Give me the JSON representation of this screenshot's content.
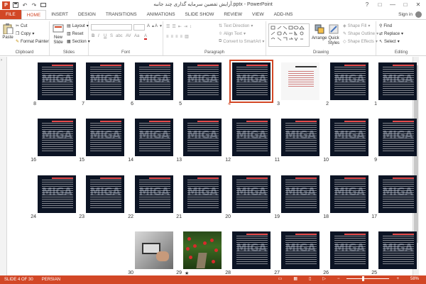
{
  "window": {
    "title": "آرایش تفضین سرمایه گذاری چند جانبه.pptx - PowerPoint",
    "app_icon": "P",
    "controls": [
      "?",
      "□",
      "—",
      "□",
      "✕"
    ]
  },
  "qat": {
    "save_icon": "save-icon",
    "undo_icon": "undo-icon",
    "redo_icon": "redo-icon"
  },
  "tabs": [
    "FILE",
    "HOME",
    "INSERT",
    "DESIGN",
    "TRANSITIONS",
    "ANIMATIONS",
    "SLIDE SHOW",
    "REVIEW",
    "VIEW",
    "ADD-INS"
  ],
  "active_tab": "HOME",
  "signin": "Sign in",
  "ribbon": {
    "clipboard": {
      "label": "Clipboard",
      "paste": "Paste",
      "cut": "Cut",
      "copy": "Copy",
      "format_painter": "Format Painter"
    },
    "slides": {
      "label": "Slides",
      "new_slide": "New Slide",
      "layout": "Layout",
      "reset": "Reset",
      "section": "Section"
    },
    "font": {
      "label": "Font",
      "bold": "B",
      "italic": "I",
      "underline": "U",
      "strike": "S",
      "shadow": "abc",
      "spacing": "AV",
      "case": "Aa",
      "color": "A"
    },
    "paragraph": {
      "label": "Paragraph",
      "text_direction": "Text Direction",
      "align_text": "Align Text",
      "smartart": "Convert to SmartArt"
    },
    "drawing": {
      "label": "Drawing",
      "arrange": "Arrange",
      "quick_styles": "Quick Styles",
      "shape_fill": "Shape Fill",
      "shape_outline": "Shape Outline",
      "shape_effects": "Shape Effects"
    },
    "editing": {
      "label": "Editing",
      "find": "Find",
      "replace": "Replace",
      "select": "Select"
    }
  },
  "slides": [
    {
      "n": "1",
      "kind": "dark"
    },
    {
      "n": "2",
      "kind": "dark"
    },
    {
      "n": "3",
      "kind": "light"
    },
    {
      "n": "4",
      "kind": "dark",
      "selected": true
    },
    {
      "n": "5",
      "kind": "dark"
    },
    {
      "n": "6",
      "kind": "dark"
    },
    {
      "n": "7",
      "kind": "dark"
    },
    {
      "n": "8",
      "kind": "dark"
    },
    {
      "n": "9",
      "kind": "dark"
    },
    {
      "n": "10",
      "kind": "dark"
    },
    {
      "n": "11",
      "kind": "dark"
    },
    {
      "n": "12",
      "kind": "dark"
    },
    {
      "n": "13",
      "kind": "dark"
    },
    {
      "n": "14",
      "kind": "dark"
    },
    {
      "n": "15",
      "kind": "dark"
    },
    {
      "n": "16",
      "kind": "dark"
    },
    {
      "n": "17",
      "kind": "dark"
    },
    {
      "n": "18",
      "kind": "dark"
    },
    {
      "n": "19",
      "kind": "dark"
    },
    {
      "n": "20",
      "kind": "dark"
    },
    {
      "n": "21",
      "kind": "dark"
    },
    {
      "n": "22",
      "kind": "dark"
    },
    {
      "n": "23",
      "kind": "dark"
    },
    {
      "n": "24",
      "kind": "dark"
    },
    {
      "n": "25",
      "kind": "dark"
    },
    {
      "n": "26",
      "kind": "dark"
    },
    {
      "n": "27",
      "kind": "dark"
    },
    {
      "n": "28",
      "kind": "dark"
    },
    {
      "n": "29",
      "kind": "photo2",
      "star": true
    },
    {
      "n": "30",
      "kind": "photo1"
    }
  ],
  "watermark": "MIGA",
  "transition_marker": "★",
  "status": {
    "slide": "SLIDE 4 OF 30",
    "language": "PERSIAN",
    "zoom": "58%"
  },
  "colors": {
    "accent": "#d24726",
    "slide_bg": "#0c1424"
  }
}
